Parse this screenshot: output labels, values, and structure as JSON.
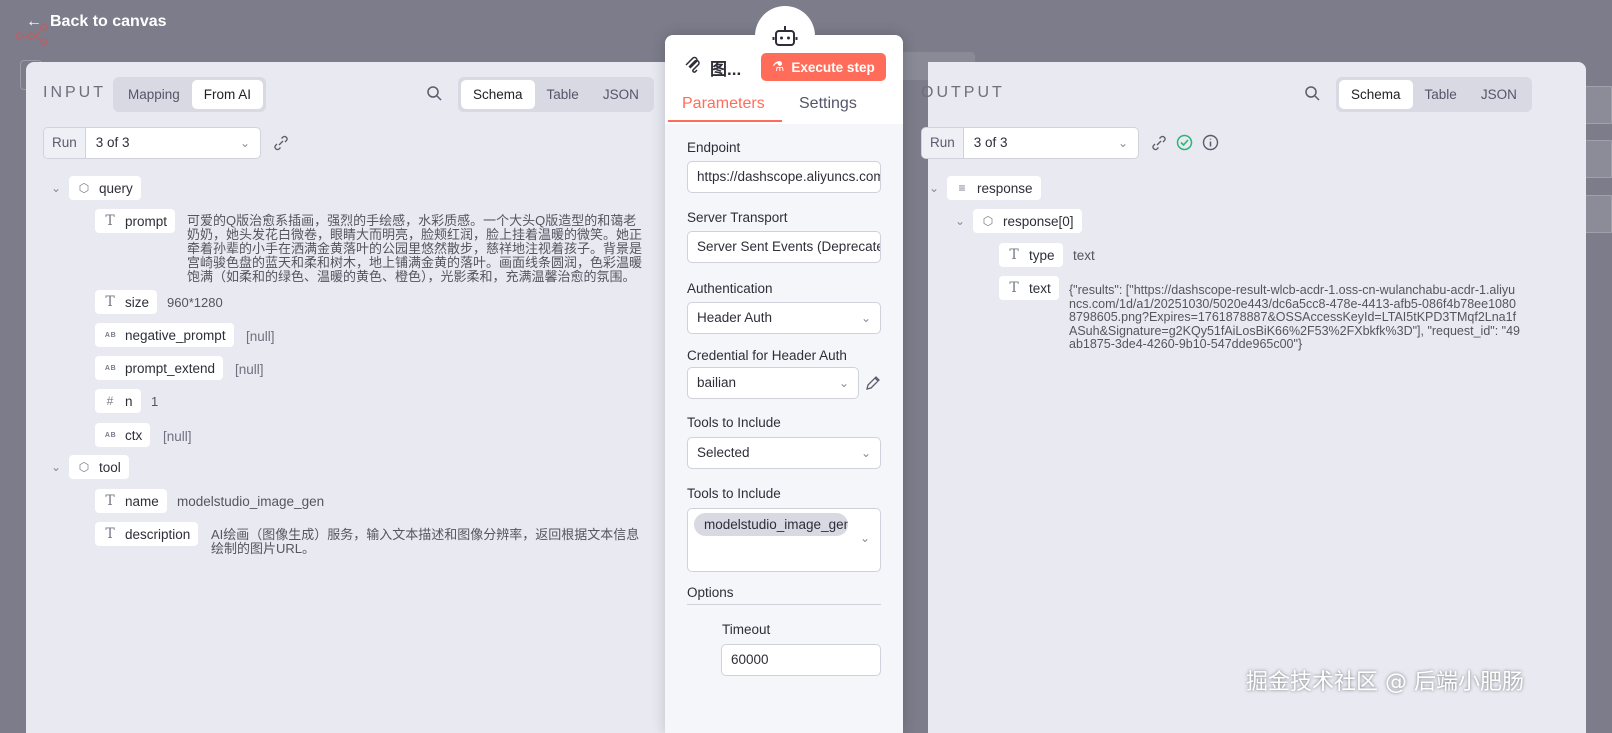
{
  "nav": {
    "back_label": "Back to canvas"
  },
  "node": {
    "title": "图...",
    "execute_label": "Execute step"
  },
  "tabs": {
    "parameters": "Parameters",
    "settings": "Settings"
  },
  "input": {
    "header": "INPUT",
    "mode_tabs": [
      "Mapping",
      "From AI"
    ],
    "view_tabs": [
      "Schema",
      "Table",
      "JSON"
    ],
    "run_label": "Run",
    "run_value": "3 of 3",
    "query_key": "query",
    "fields": {
      "prompt": {
        "key": "prompt",
        "value": "可爱的Q版治愈系插画，强烈的手绘感，水彩质感。一个大头Q版造型的和蔼老奶奶，她头发花白微卷，眼睛大而明亮，脸颊红润，脸上挂着温暖的微笑。她正牵着孙辈的小手在洒满金黄落叶的公园里悠然散步，慈祥地注视着孩子。背景是宫崎骏色盘的蓝天和柔和树木，地上铺满金黄的落叶。画面线条圆润，色彩温暖饱满（如柔和的绿色、温暖的黄色、橙色），光影柔和，充满温馨治愈的氛围。"
      },
      "size": {
        "key": "size",
        "value": "960*1280"
      },
      "negative_prompt": {
        "key": "negative_prompt",
        "value": "[null]"
      },
      "prompt_extend": {
        "key": "prompt_extend",
        "value": "[null]"
      },
      "n": {
        "key": "n",
        "value": "1"
      },
      "ctx": {
        "key": "ctx",
        "value": "[null]"
      }
    },
    "tool_key": "tool",
    "tool": {
      "name": {
        "key": "name",
        "value": "modelstudio_image_gen"
      },
      "description": {
        "key": "description",
        "value": "AI绘画（图像生成）服务，输入文本描述和图像分辨率，返回根据文本信息绘制的图片URL。"
      }
    }
  },
  "params": {
    "endpoint_label": "Endpoint",
    "endpoint_value": "https://dashscope.aliyuncs.com",
    "transport_label": "Server Transport",
    "transport_value": "Server Sent Events (Deprecated)",
    "auth_label": "Authentication",
    "auth_value": "Header Auth",
    "cred_label": "Credential for Header Auth",
    "cred_value": "bailian",
    "tools_label": "Tools to Include",
    "tools_value": "Selected",
    "tools2_label": "Tools to Include",
    "tools2_chip": "modelstudio_image_gen",
    "options_label": "Options",
    "timeout_label": "Timeout",
    "timeout_value": "60000"
  },
  "output": {
    "header": "OUTPUT",
    "view_tabs": [
      "Schema",
      "Table",
      "JSON"
    ],
    "run_label": "Run",
    "run_value": "3 of 3",
    "response_key": "response",
    "response0_key": "response[0]",
    "type_key": "type",
    "type_value": "text",
    "text_key": "text",
    "text_value": "{\"results\": [\"https://dashscope-result-wlcb-acdr-1.oss-cn-wulanchabu-acdr-1.aliyuncs.com/1d/a1/20251030/5020e443/dc6a5cc8-478e-4413-afb5-086f4b78ee10808798605.png?Expires=1761878887&OSSAccessKeyId=LTAI5tKPD3TMqf2Lna1fASuh&Signature=g2KQy51fAiLosBiK66%2F53%2FXbkfk%3D\"], \"request_id\": \"49ab1875-3de4-4260-9b10-547dde965c00\"}"
  },
  "watermark": "掘金技术社区 @ 后端小肥肠",
  "colors": {
    "accent": "#ff6d5a",
    "panel_bg": "#e8e9f1",
    "success": "#2bb673"
  }
}
